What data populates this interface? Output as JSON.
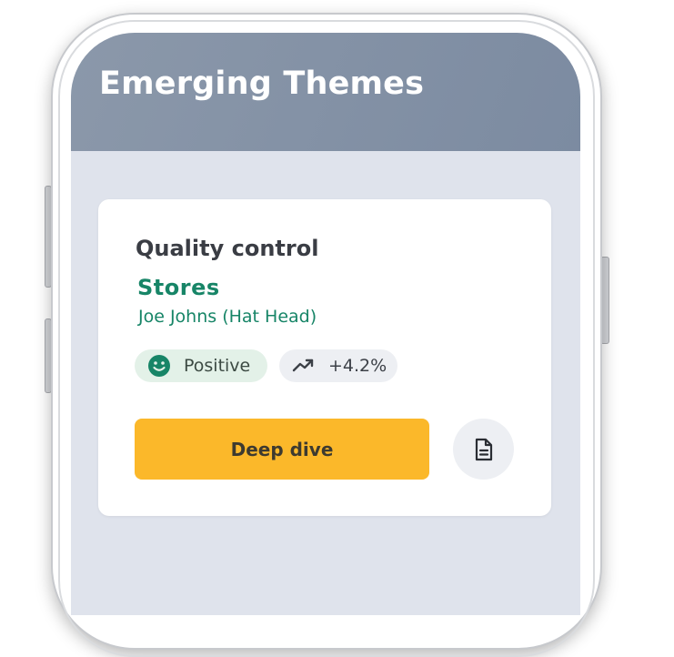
{
  "app": {
    "header_title": "Emerging Themes"
  },
  "card": {
    "title": "Quality control",
    "category": "Stores",
    "person": "Joe Johns (Hat Head)",
    "sentiment": {
      "label": "Positive",
      "icon": "smiley-face-icon",
      "color": "#178567"
    },
    "trend": {
      "value": "+4.2%",
      "icon": "trending-up-icon"
    },
    "primary_action": {
      "label": "Deep dive",
      "color": "#fbb82a"
    },
    "secondary_action": {
      "icon": "document-icon"
    }
  },
  "colors": {
    "header": "#8391a5",
    "screen_background": "#dfe3ec",
    "accent_green": "#178567"
  }
}
